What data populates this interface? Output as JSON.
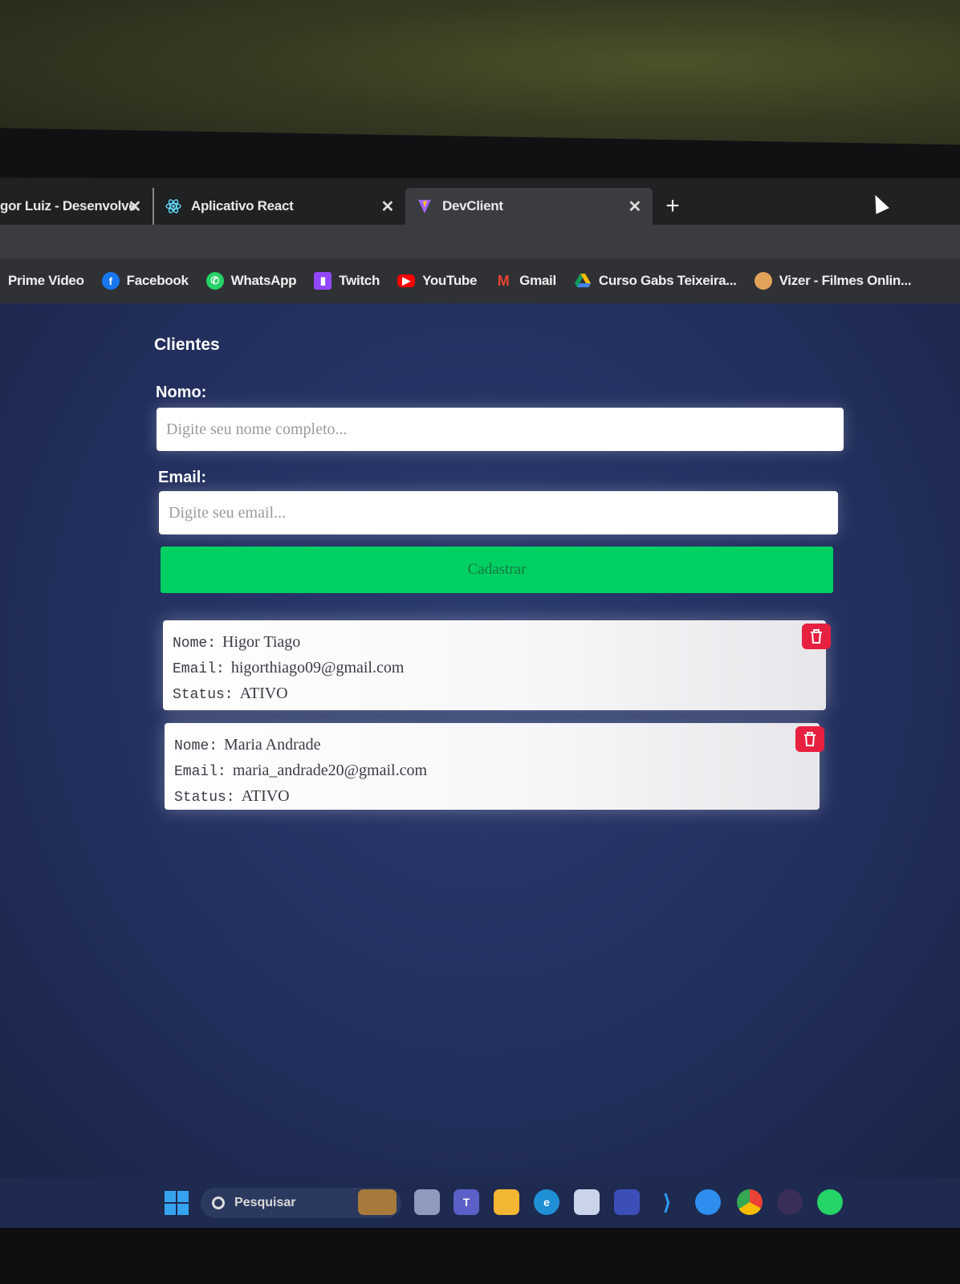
{
  "browser": {
    "tabs": [
      {
        "title": "gor Luiz - Desenvolve",
        "icon": "site-icon"
      },
      {
        "title": "Aplicativo React",
        "icon": "react-icon"
      },
      {
        "title": "DevClient",
        "icon": "vite-icon",
        "active": true
      }
    ],
    "new_tab": "+",
    "close_glyph": "✕",
    "bookmarks": [
      {
        "label": "Prime Video",
        "icon": "prime-video-icon"
      },
      {
        "label": "Facebook",
        "icon": "facebook-icon",
        "color": "#1877f2"
      },
      {
        "label": "WhatsApp",
        "icon": "whatsapp-icon",
        "color": "#25d366"
      },
      {
        "label": "Twitch",
        "icon": "twitch-icon",
        "color": "#9146ff"
      },
      {
        "label": "YouTube",
        "icon": "youtube-icon",
        "color": "#ff0000"
      },
      {
        "label": "Gmail",
        "icon": "gmail-icon",
        "color": "#ea4335"
      },
      {
        "label": "Curso Gabs Teixeira...",
        "icon": "google-drive-icon",
        "color": "#fbbc04"
      },
      {
        "label": "Vizer - Filmes Onlin...",
        "icon": "vizer-icon",
        "color": "#e3a25b"
      }
    ]
  },
  "page": {
    "title": "Clientes",
    "nome_label": "Nomo:",
    "nome_placeholder": "Digite seu nome completo...",
    "email_label": "Email:",
    "email_placeholder": "Digite seu email...",
    "submit_label": "Cadastrar",
    "accent": "#00d062",
    "delete_color": "#e8203f"
  },
  "clients": [
    {
      "nome_key": "Nome:",
      "nome": "Higor Tiago",
      "email_key": "Email:",
      "email": "higorthiago09@gmail.com",
      "status_key": "Status:",
      "status": "ATIVO"
    },
    {
      "nome_key": "Nome:",
      "nome": "Maria Andrade",
      "email_key": "Email:",
      "email": "maria_andrade20@gmail.com",
      "status_key": "Status:",
      "status": "ATIVO"
    }
  ],
  "taskbar": {
    "search_label": "Pesquisar",
    "apps": [
      "widgets-icon",
      "task-view-icon",
      "teams-icon",
      "file-explorer-icon",
      "edge-icon",
      "store-icon",
      "vscode-insiders-icon",
      "vscode-icon",
      "docker-icon",
      "chrome-icon",
      "obs-icon",
      "whatsapp-icon"
    ]
  }
}
